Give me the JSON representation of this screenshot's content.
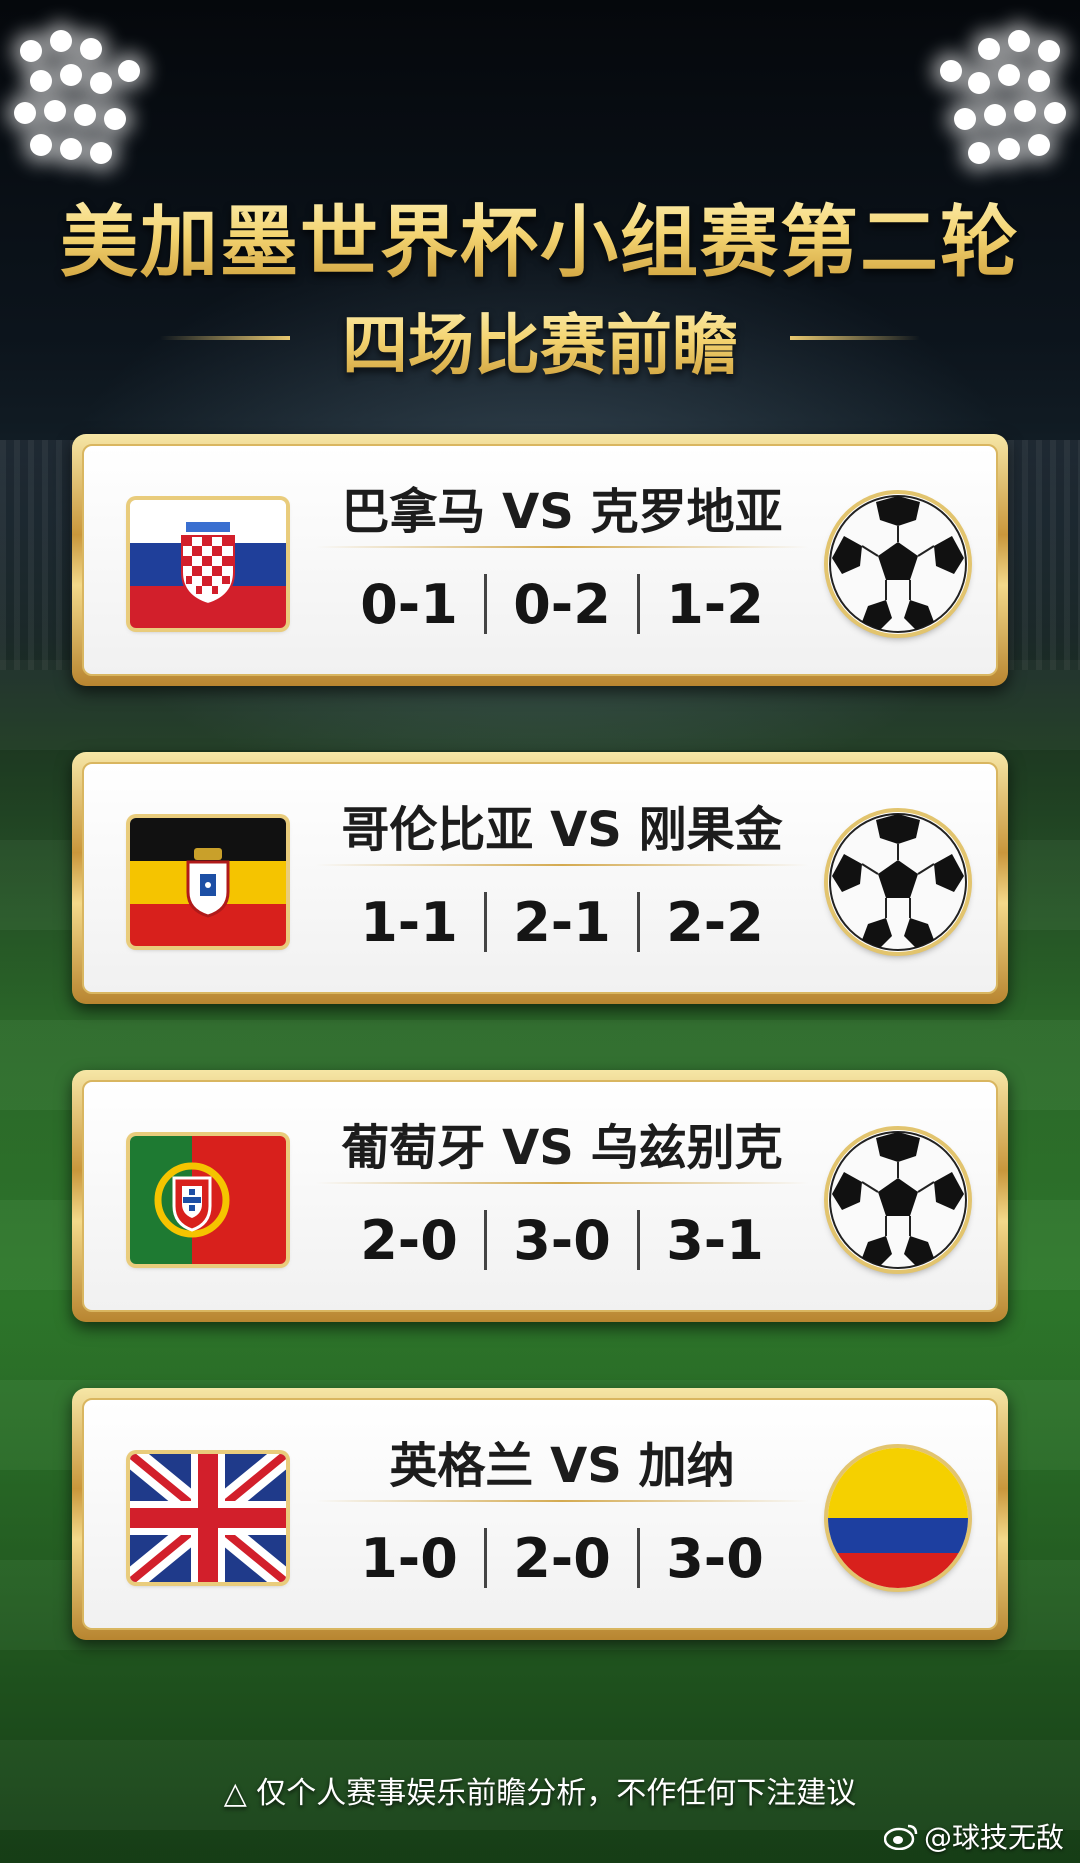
{
  "header": {
    "title_line1": "美加墨世界杯小组赛第二轮",
    "title_line2": "四场比赛前瞻"
  },
  "matches": [
    {
      "name": "巴拿马 VS 克罗地亚",
      "scores": [
        "0-1",
        "0-2",
        "1-2"
      ],
      "flag_icon": "croatia-flag-icon",
      "right_icon": "soccer-ball-icon"
    },
    {
      "name": "哥伦比亚 VS 刚果金",
      "scores": [
        "1-1",
        "2-1",
        "2-2"
      ],
      "flag_icon": "black-yellow-red-flag-icon",
      "right_icon": "soccer-ball-icon"
    },
    {
      "name": "葡萄牙 VS 乌兹别克",
      "scores": [
        "2-0",
        "3-0",
        "3-1"
      ],
      "flag_icon": "portugal-flag-icon",
      "right_icon": "soccer-ball-icon"
    },
    {
      "name": "英格兰 VS 加纳",
      "scores": [
        "1-0",
        "2-0",
        "3-0"
      ],
      "flag_icon": "union-jack-flag-icon",
      "right_icon": "colombia-flag-circle-icon"
    }
  ],
  "footer": {
    "disclaimer": "△ 仅个人赛事娱乐前瞻分析，不作任何下注建议",
    "watermark": "@球技无敌"
  },
  "colors": {
    "gold": "#e8c870",
    "card_bg": "#ffffff",
    "text": "#151515"
  }
}
